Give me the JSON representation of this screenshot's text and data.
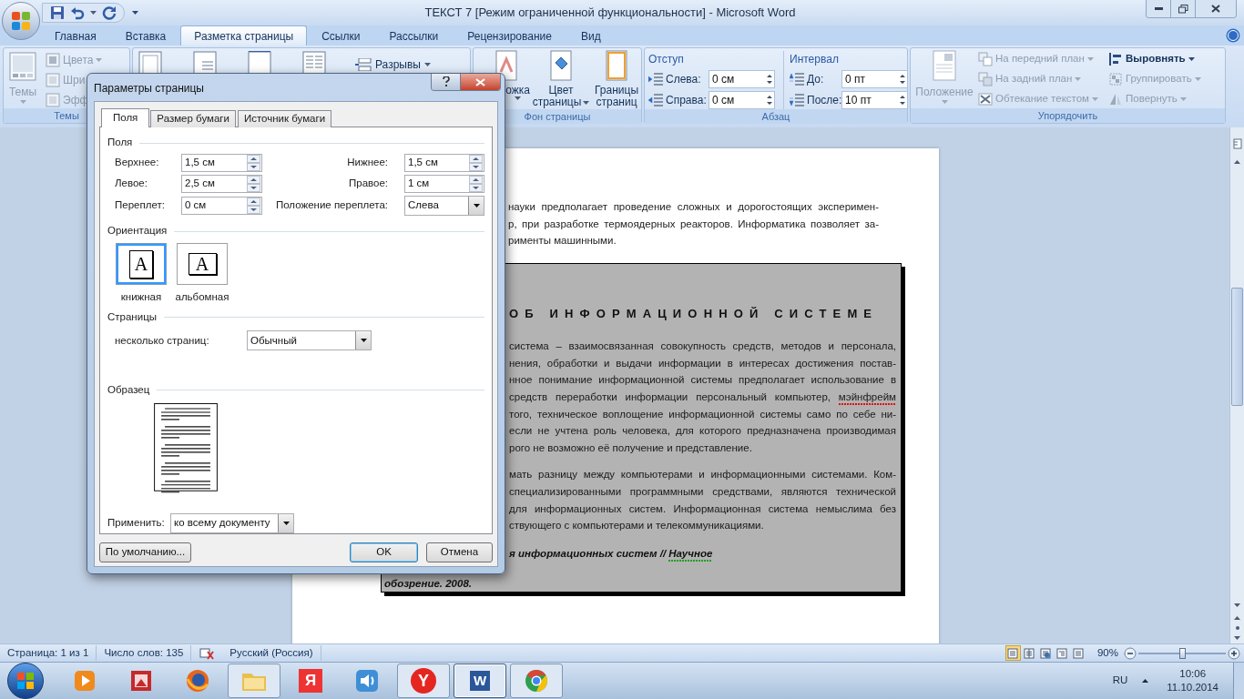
{
  "window": {
    "title": "ТЕКСТ 7 [Режим ограниченной функциональности] - Microsoft Word"
  },
  "ribbon_tabs": [
    {
      "label": "Главная",
      "selected": false
    },
    {
      "label": "Вставка",
      "selected": false
    },
    {
      "label": "Разметка страницы",
      "selected": true
    },
    {
      "label": "Ссылки",
      "selected": false
    },
    {
      "label": "Рассылки",
      "selected": false
    },
    {
      "label": "Рецензирование",
      "selected": false
    },
    {
      "label": "Вид",
      "selected": false
    }
  ],
  "ribbon": {
    "themes": {
      "label": "Темы",
      "button": {
        "label": "Темы",
        "disabled": true
      },
      "items": [
        {
          "label": "Цвета",
          "disabled": true
        },
        {
          "label": "Шри",
          "disabled": true
        },
        {
          "label": "Эфф",
          "disabled": true
        }
      ]
    },
    "page_setup": {
      "breaks": {
        "label": "Разрывы"
      }
    },
    "page_background": {
      "label": "Фон страницы",
      "buttons": [
        {
          "kind": "watermark",
          "lines": [
            "ожка"
          ]
        },
        {
          "kind": "color",
          "lines": [
            "Цвет",
            "страницы"
          ]
        },
        {
          "kind": "borders",
          "lines": [
            "Границы",
            "страниц"
          ]
        }
      ]
    },
    "paragraph": {
      "label": "Абзац",
      "indent": {
        "title": "Отступ",
        "fields": [
          {
            "kind": "left",
            "label": "Слева:",
            "value": "0 см"
          },
          {
            "kind": "right",
            "label": "Справа:",
            "value": "0 см"
          }
        ]
      },
      "spacing": {
        "title": "Интервал",
        "fields": [
          {
            "kind": "before",
            "label": "До:",
            "value": "0 пт"
          },
          {
            "kind": "after",
            "label": "После:",
            "value": "10 пт"
          }
        ]
      }
    },
    "arrange": {
      "label": "Упорядочить",
      "position": {
        "label": "Положение",
        "disabled": true
      },
      "columns": [
        [
          {
            "kind": "front",
            "label": "На передний план",
            "disabled": true
          },
          {
            "kind": "back",
            "label": "На задний план",
            "disabled": true
          },
          {
            "kind": "wrap",
            "label": "Обтекание текстом",
            "disabled": true
          }
        ],
        [
          {
            "kind": "align",
            "label": "Выровнять",
            "disabled": false
          },
          {
            "kind": "group",
            "label": "Группировать",
            "disabled": true
          },
          {
            "kind": "rotate",
            "label": "Повернуть",
            "disabled": true
          }
        ]
      ]
    }
  },
  "dialog": {
    "title": "Параметры страницы",
    "tabs": [
      {
        "label": "Поля",
        "selected": true
      },
      {
        "label": "Размер бумаги",
        "selected": false
      },
      {
        "label": "Источник бумаги",
        "selected": false
      }
    ],
    "margins": {
      "title": "Поля",
      "fields": [
        {
          "label": "Верхнее:",
          "value": "1,5 см"
        },
        {
          "label": "Нижнее:",
          "value": "1,5 см"
        },
        {
          "label": "Левое:",
          "value": "2,5 см"
        },
        {
          "label": "Правое:",
          "value": "1 см"
        },
        {
          "label": "Переплет:",
          "value": "0 см"
        }
      ],
      "gutter_position": {
        "label": "Положение переплета:",
        "value": "Слева"
      }
    },
    "orientation": {
      "title": "Ориентация",
      "options": [
        {
          "label": "книжная",
          "kind": "portrait",
          "glyph": "A",
          "selected": true
        },
        {
          "label": "альбомная",
          "kind": "landscape",
          "glyph": "A",
          "selected": false
        }
      ]
    },
    "pages": {
      "title": "Страницы",
      "label": "несколько страниц:",
      "value": "Обычный"
    },
    "preview": {
      "title": "Образец"
    },
    "apply": {
      "label": "Применить:",
      "value": "ко всему документу"
    },
    "buttons": [
      {
        "label": "По умолчанию...",
        "kind": "default"
      },
      {
        "label": "OK",
        "kind": "primary"
      },
      {
        "label": "Отмена",
        "kind": "cancel"
      }
    ]
  },
  "document": {
    "lines": [
      "науки предполагает проведение сложных и дорогостоящих эксперимен-",
      "р, при разработке термоядерных реакторов. Информатика позволяет за-",
      "рименты машинными."
    ],
    "box": {
      "title": "ОБ ИНФОРМАЦИОННОЙ СИСТЕМЕ",
      "paragraphs": [
        [
          {
            "text": "система – взаимосвязанная совокупность средств, методов и персонала,"
          },
          {
            "text": "нения, обработки и выдачи информации в интересах достижения постав-"
          },
          {
            "text": "нное понимание информационной системы предполагает использование в"
          },
          {
            "text": "средств переработки информации персональный компьютер, ",
            "flag": "мэйнфрейм",
            "color": "#e01010"
          },
          {
            "text": "того, техническое воплощение информационной системы само по себе ни-"
          },
          {
            "text": "если не учтена роль человека, для которого предназначена производимая"
          },
          {
            "text": "рого не возможно её получение и представление."
          }
        ],
        [
          {
            "text": "мать разницу между компьютерами и информационными системами. Ком-"
          },
          {
            "text": "специализированными программными средствами, являются технической"
          },
          {
            "text": "для информационных систем. Информационная система немыслима без"
          },
          {
            "text": "ствующего с компьютерами и телекоммуникациями."
          }
        ]
      ],
      "citation": [
        {
          "text": "я информационных систем // ",
          "flag": "Научное",
          "color": "#20a020"
        },
        {
          "text": "обозрение. 2008."
        }
      ]
    }
  },
  "status_bar": {
    "items": [
      "Страница: 1 из 1",
      "Число слов: 135"
    ],
    "language": "Русский (Россия)",
    "views": [
      {
        "kind": "print",
        "selected": true
      },
      {
        "kind": "reading",
        "selected": false
      },
      {
        "kind": "web",
        "selected": false
      },
      {
        "kind": "outline",
        "selected": false
      },
      {
        "kind": "draft",
        "selected": false
      }
    ],
    "zoom": "90%",
    "zoom_slider": {
      "level": 0.5
    }
  },
  "taskbar": {
    "apps": [
      {
        "kind": "media",
        "running": false,
        "selected": false
      },
      {
        "kind": "slides",
        "running": false,
        "selected": false
      },
      {
        "kind": "browser_fox",
        "running": false,
        "selected": false
      },
      {
        "kind": "folder",
        "running": true,
        "selected": false
      },
      {
        "kind": "tile",
        "glyph": "Я",
        "running": false,
        "selected": false
      },
      {
        "kind": "speaker",
        "running": false,
        "selected": false
      },
      {
        "kind": "round_tile",
        "glyph": "Y",
        "running": true,
        "selected": false
      },
      {
        "kind": "doc_tile",
        "glyph": "W",
        "running": true,
        "selected": true
      },
      {
        "kind": "chrome",
        "running": true,
        "selected": false
      }
    ],
    "language": "RU",
    "time": "10:06",
    "date": "11.10.2014"
  }
}
